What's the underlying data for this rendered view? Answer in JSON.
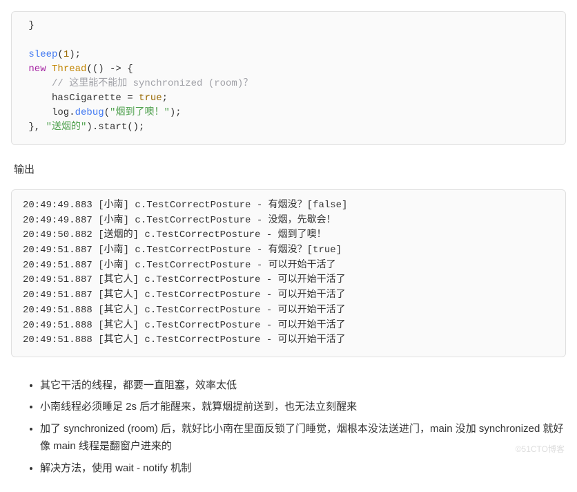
{
  "code": {
    "br_open_1": " }",
    "blank1": "",
    "sleep_fn": " sleep",
    "sleep_arg_open": "(",
    "sleep_num": "1",
    "sleep_arg_close": ");",
    "new_kw": " new",
    "thread_cls": " Thread",
    "lambda_open": "(() -> {",
    "comment_line": "     // 这里能不能加 synchronized (room)？",
    "has_var": "     hasCigarette",
    "eq": " = ",
    "true_val": "true",
    "semi1": ";",
    "log_prefix": "     log.",
    "debug_fn": "debug",
    "dbg_open": "(",
    "dbg_str": "\"烟到了噢！\"",
    "dbg_close": ");",
    "lambda_close": " }, ",
    "thread_name_str": "\"送烟的\"",
    "start_call": ").start();"
  },
  "output_label": "输出",
  "output_lines": [
    "20:49:49.883 [小南] c.TestCorrectPosture - 有烟没？[false]",
    "20:49:49.887 [小南] c.TestCorrectPosture - 没烟，先歇会！",
    "20:49:50.882 [送烟的] c.TestCorrectPosture - 烟到了噢！",
    "20:49:51.887 [小南] c.TestCorrectPosture - 有烟没？[true]",
    "20:49:51.887 [小南] c.TestCorrectPosture - 可以开始干活了",
    "20:49:51.887 [其它人] c.TestCorrectPosture - 可以开始干活了",
    "20:49:51.887 [其它人] c.TestCorrectPosture - 可以开始干活了",
    "20:49:51.888 [其它人] c.TestCorrectPosture - 可以开始干活了",
    "20:49:51.888 [其它人] c.TestCorrectPosture - 可以开始干活了",
    "20:49:51.888 [其它人] c.TestCorrectPosture - 可以开始干活了"
  ],
  "notes": [
    "其它干活的线程，都要一直阻塞，效率太低",
    "小南线程必须睡足 2s 后才能醒来，就算烟提前送到，也无法立刻醒来",
    "加了 synchronized (room) 后，就好比小南在里面反锁了门睡觉，烟根本没法送进门，main 没加 synchronized 就好像 main 线程是翻窗户进来的",
    "解决方法，使用 wait - notify 机制"
  ],
  "watermark": "©51CTO博客"
}
